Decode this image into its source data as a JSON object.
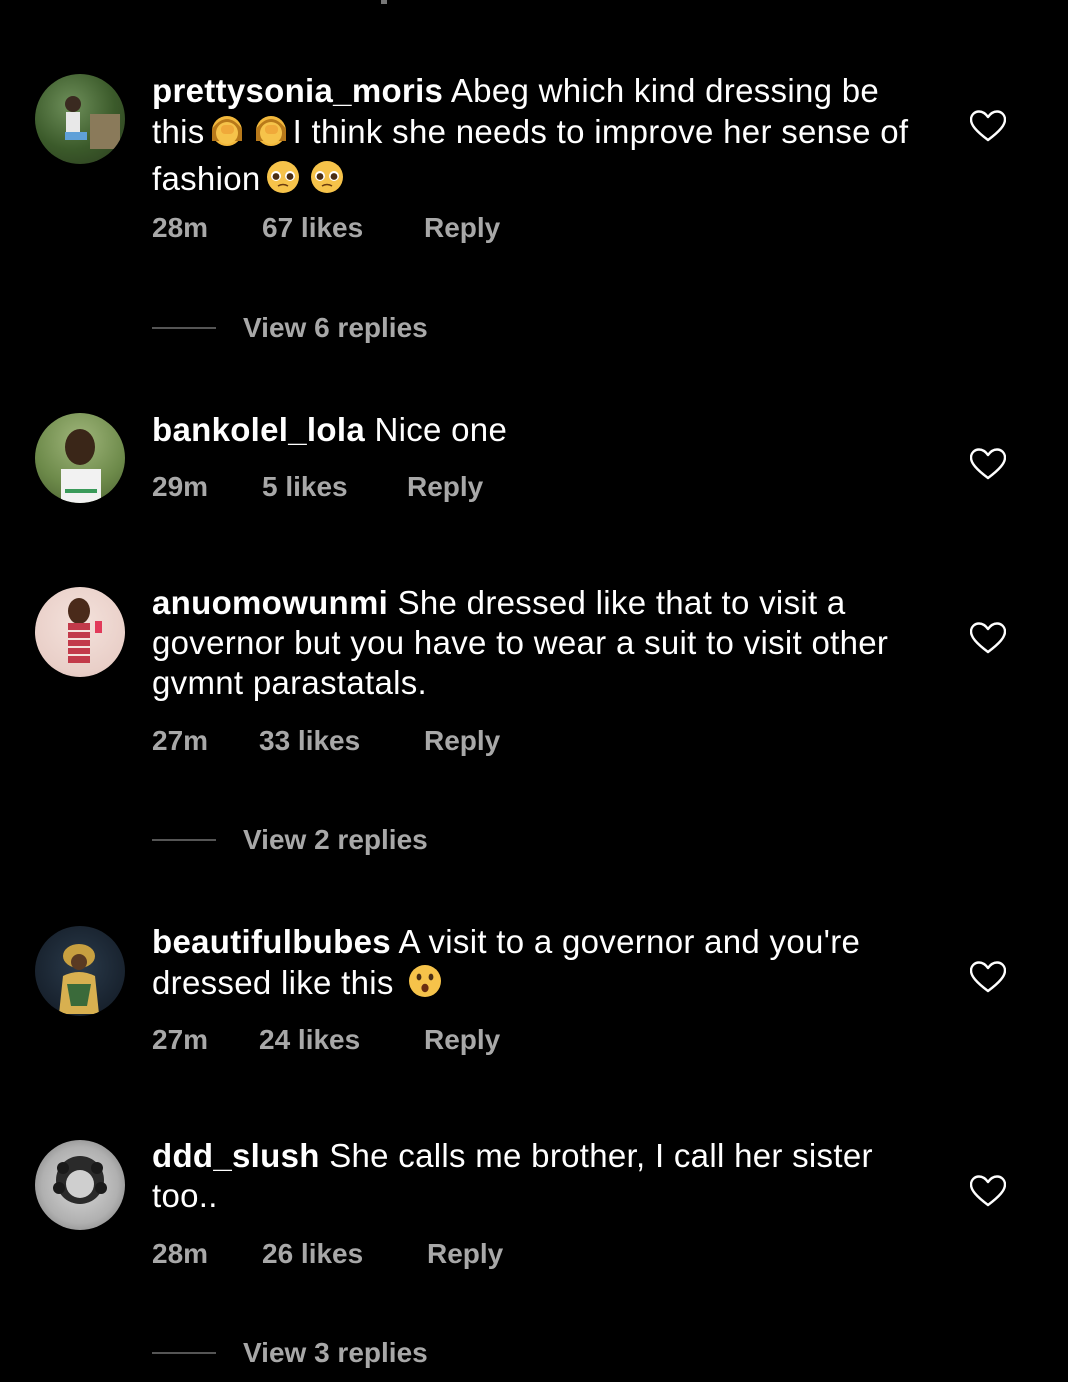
{
  "comments": [
    {
      "username": "prettysonia_moris",
      "text_parts": [
        "Abeg which kind dressing be this",
        "I think she needs to improve her sense of fashion"
      ],
      "time": "28m",
      "likes": "67 likes",
      "reply": "Reply",
      "view_replies": "View 6 replies"
    },
    {
      "username": "bankolel_lola",
      "text_parts": [
        "Nice one"
      ],
      "time": "29m",
      "likes": "5 likes",
      "reply": "Reply"
    },
    {
      "username": "anuomowunmi",
      "text_parts": [
        "She dressed like that to visit a governor but you have to wear a suit to visit other gvmnt parastatals."
      ],
      "time": "27m",
      "likes": "33 likes",
      "reply": "Reply",
      "view_replies": "View 2 replies"
    },
    {
      "username": "beautifulbubes",
      "text_parts": [
        "A visit to a governor and you're dressed like this"
      ],
      "time": "27m",
      "likes": "24 likes",
      "reply": "Reply"
    },
    {
      "username": "ddd_slush",
      "text_parts": [
        "She calls me brother, I call her sister too.."
      ],
      "time": "28m",
      "likes": "26 likes",
      "reply": "Reply",
      "view_replies": "View 3 replies"
    }
  ],
  "icons": {
    "like": "heart-outline-icon",
    "emoji_facepalm": "woman-facepalming-emoji",
    "emoji_pleading": "pleading-face-emoji",
    "emoji_surprised": "hushed-face-emoji"
  },
  "colors": {
    "background": "#000000",
    "primary_text": "#ffffff",
    "secondary_text": "#a8a8a8"
  }
}
